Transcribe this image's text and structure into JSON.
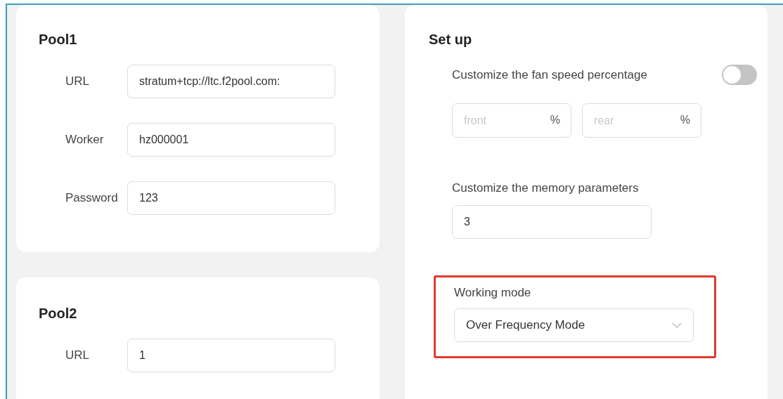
{
  "pools": [
    {
      "title": "Pool1",
      "fields": [
        {
          "label": "URL",
          "value": "stratum+tcp://ltc.f2pool.com:"
        },
        {
          "label": "Worker",
          "value": "hz000001"
        },
        {
          "label": "Password",
          "value": "123"
        }
      ]
    },
    {
      "title": "Pool2",
      "fields": [
        {
          "label": "URL",
          "value": "1"
        }
      ]
    }
  ],
  "setup": {
    "title": "Set up",
    "fan": {
      "label": "Customize the fan speed percentage",
      "on": false,
      "inputs": [
        {
          "placeholder": "front",
          "unit": "%"
        },
        {
          "placeholder": "rear",
          "unit": "%"
        }
      ]
    },
    "memory": {
      "label": "Customize the memory parameters",
      "value": "3"
    },
    "working_mode": {
      "label": "Working mode",
      "value": "Over Frequency Mode",
      "highlighted": true
    }
  }
}
